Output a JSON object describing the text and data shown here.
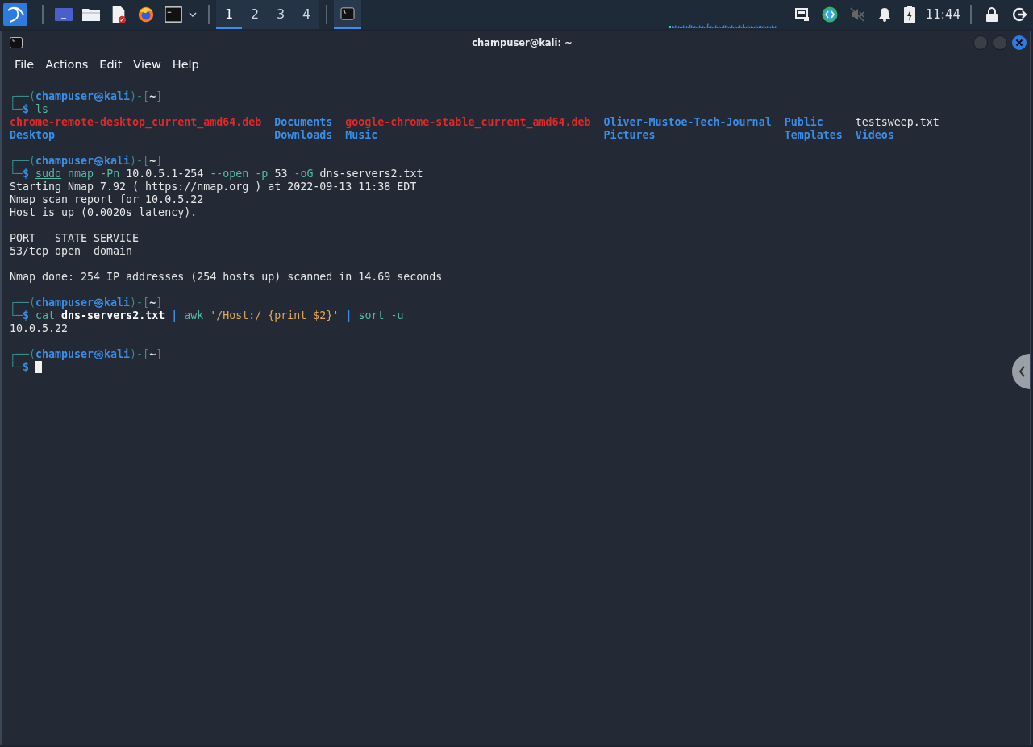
{
  "taskbar": {
    "workspaces": [
      {
        "label": "1",
        "selected": true
      },
      {
        "label": "2",
        "selected": false
      },
      {
        "label": "3",
        "selected": false
      },
      {
        "label": "4",
        "selected": false
      }
    ],
    "clock": "11:44"
  },
  "window": {
    "title": "champuser@kali: ~"
  },
  "menu": [
    "File",
    "Actions",
    "Edit",
    "View",
    "Help"
  ],
  "terminal": {
    "lines": [
      {
        "kind": "prompt",
        "segments": [
          {
            "kind": "frame",
            "text": "┌──("
          },
          {
            "kind": "user",
            "text": "champuser㉿kali"
          },
          {
            "kind": "frame",
            "text": ")-["
          },
          {
            "kind": "path",
            "text": "~"
          },
          {
            "kind": "frame",
            "text": "]"
          }
        ]
      },
      {
        "kind": "command",
        "segments": [
          {
            "kind": "frame",
            "text": "└─"
          },
          {
            "kind": "dollar",
            "text": "$"
          },
          {
            "kind": "cmd",
            "gap": true,
            "text": "ls"
          }
        ]
      },
      {
        "kind": "ls",
        "columns": [
          [
            {
              "kind": "archive",
              "text": "chrome-remote-desktop_current_amd64.deb"
            },
            {
              "kind": "dir",
              "text": "Desktop"
            }
          ],
          [
            {
              "kind": "dir",
              "text": "Documents"
            },
            {
              "kind": "dir",
              "text": "Downloads"
            }
          ],
          [
            {
              "kind": "archive",
              "text": "google-chrome-stable_current_amd64.deb"
            },
            {
              "kind": "dir",
              "text": "Music"
            }
          ],
          [
            {
              "kind": "dir",
              "text": "Oliver-Mustoe-Tech-Journal"
            },
            {
              "kind": "dir",
              "text": "Pictures"
            }
          ],
          [
            {
              "kind": "dir",
              "text": "Public"
            },
            {
              "kind": "dir",
              "text": "Templates"
            }
          ],
          [
            {
              "kind": "file",
              "text": "testsweep.txt"
            },
            {
              "kind": "dir",
              "text": "Videos"
            }
          ]
        ]
      },
      {
        "kind": "prompt",
        "blank_before": true,
        "segments": [
          {
            "kind": "frame",
            "text": "┌──("
          },
          {
            "kind": "user",
            "text": "champuser㉿kali"
          },
          {
            "kind": "frame",
            "text": ")-["
          },
          {
            "kind": "path",
            "text": "~"
          },
          {
            "kind": "frame",
            "text": "]"
          }
        ]
      },
      {
        "kind": "command",
        "segments": [
          {
            "kind": "frame",
            "text": "└─"
          },
          {
            "kind": "dollar",
            "text": "$"
          },
          {
            "kind": "sudo",
            "gap": true,
            "text": "sudo"
          },
          {
            "kind": "cmd",
            "gap": true,
            "text": "nmap"
          },
          {
            "kind": "opt",
            "gap": true,
            "text": "-Pn"
          },
          {
            "kind": "arg",
            "gap": true,
            "text": "10.0.5.1-254"
          },
          {
            "kind": "opt",
            "gap": true,
            "text": "--open"
          },
          {
            "kind": "opt",
            "gap": true,
            "text": "-p"
          },
          {
            "kind": "arg",
            "gap": true,
            "text": "53"
          },
          {
            "kind": "opt",
            "gap": true,
            "text": "-oG"
          },
          {
            "kind": "arg",
            "gap": true,
            "text": "dns-servers2.txt"
          }
        ]
      },
      {
        "kind": "output",
        "segments": [
          {
            "kind": "out",
            "text": "Starting Nmap 7.92 ( https://nmap.org ) at 2022-09-13 11:38 EDT"
          }
        ]
      },
      {
        "kind": "output",
        "segments": [
          {
            "kind": "out",
            "text": "Nmap scan report for 10.0.5.22"
          }
        ]
      },
      {
        "kind": "output",
        "segments": [
          {
            "kind": "out",
            "text": "Host is up (0.0020s latency)."
          }
        ]
      },
      {
        "kind": "output",
        "blank_before": true,
        "segments": [
          {
            "kind": "out",
            "text": "PORT   STATE SERVICE"
          }
        ]
      },
      {
        "kind": "output",
        "segments": [
          {
            "kind": "out",
            "text": "53/tcp open  domain"
          }
        ]
      },
      {
        "kind": "output",
        "blank_before": true,
        "segments": [
          {
            "kind": "out",
            "text": "Nmap done: 254 IP addresses (254 hosts up) scanned in 14.69 seconds"
          }
        ]
      },
      {
        "kind": "prompt",
        "blank_before": true,
        "segments": [
          {
            "kind": "frame",
            "text": "┌──("
          },
          {
            "kind": "user",
            "text": "champuser㉿kali"
          },
          {
            "kind": "frame",
            "text": ")-["
          },
          {
            "kind": "path",
            "text": "~"
          },
          {
            "kind": "frame",
            "text": "]"
          }
        ]
      },
      {
        "kind": "command",
        "segments": [
          {
            "kind": "frame",
            "text": "└─"
          },
          {
            "kind": "dollar",
            "text": "$"
          },
          {
            "kind": "cmd",
            "gap": true,
            "text": "cat"
          },
          {
            "kind": "file",
            "gap": true,
            "text": "dns-servers2.txt"
          },
          {
            "kind": "pipe",
            "gap": true,
            "text": "|"
          },
          {
            "kind": "cmd",
            "gap": true,
            "text": "awk"
          },
          {
            "kind": "str",
            "gap": true,
            "text": "'/Host:/ {print $2}'"
          },
          {
            "kind": "pipe",
            "gap": true,
            "text": "|"
          },
          {
            "kind": "cmd",
            "gap": true,
            "text": "sort"
          },
          {
            "kind": "opt",
            "gap": true,
            "text": "-u"
          }
        ]
      },
      {
        "kind": "output",
        "segments": [
          {
            "kind": "out",
            "text": "10.0.5.22"
          }
        ]
      },
      {
        "kind": "prompt",
        "blank_before": true,
        "segments": [
          {
            "kind": "frame",
            "text": "┌──("
          },
          {
            "kind": "user",
            "text": "champuser㉿kali"
          },
          {
            "kind": "frame",
            "text": ")-["
          },
          {
            "kind": "path",
            "text": "~"
          },
          {
            "kind": "frame",
            "text": "]"
          }
        ]
      },
      {
        "kind": "command",
        "cursor": true,
        "segments": [
          {
            "kind": "frame",
            "text": "└─"
          },
          {
            "kind": "dollar",
            "text": "$"
          }
        ]
      }
    ]
  }
}
